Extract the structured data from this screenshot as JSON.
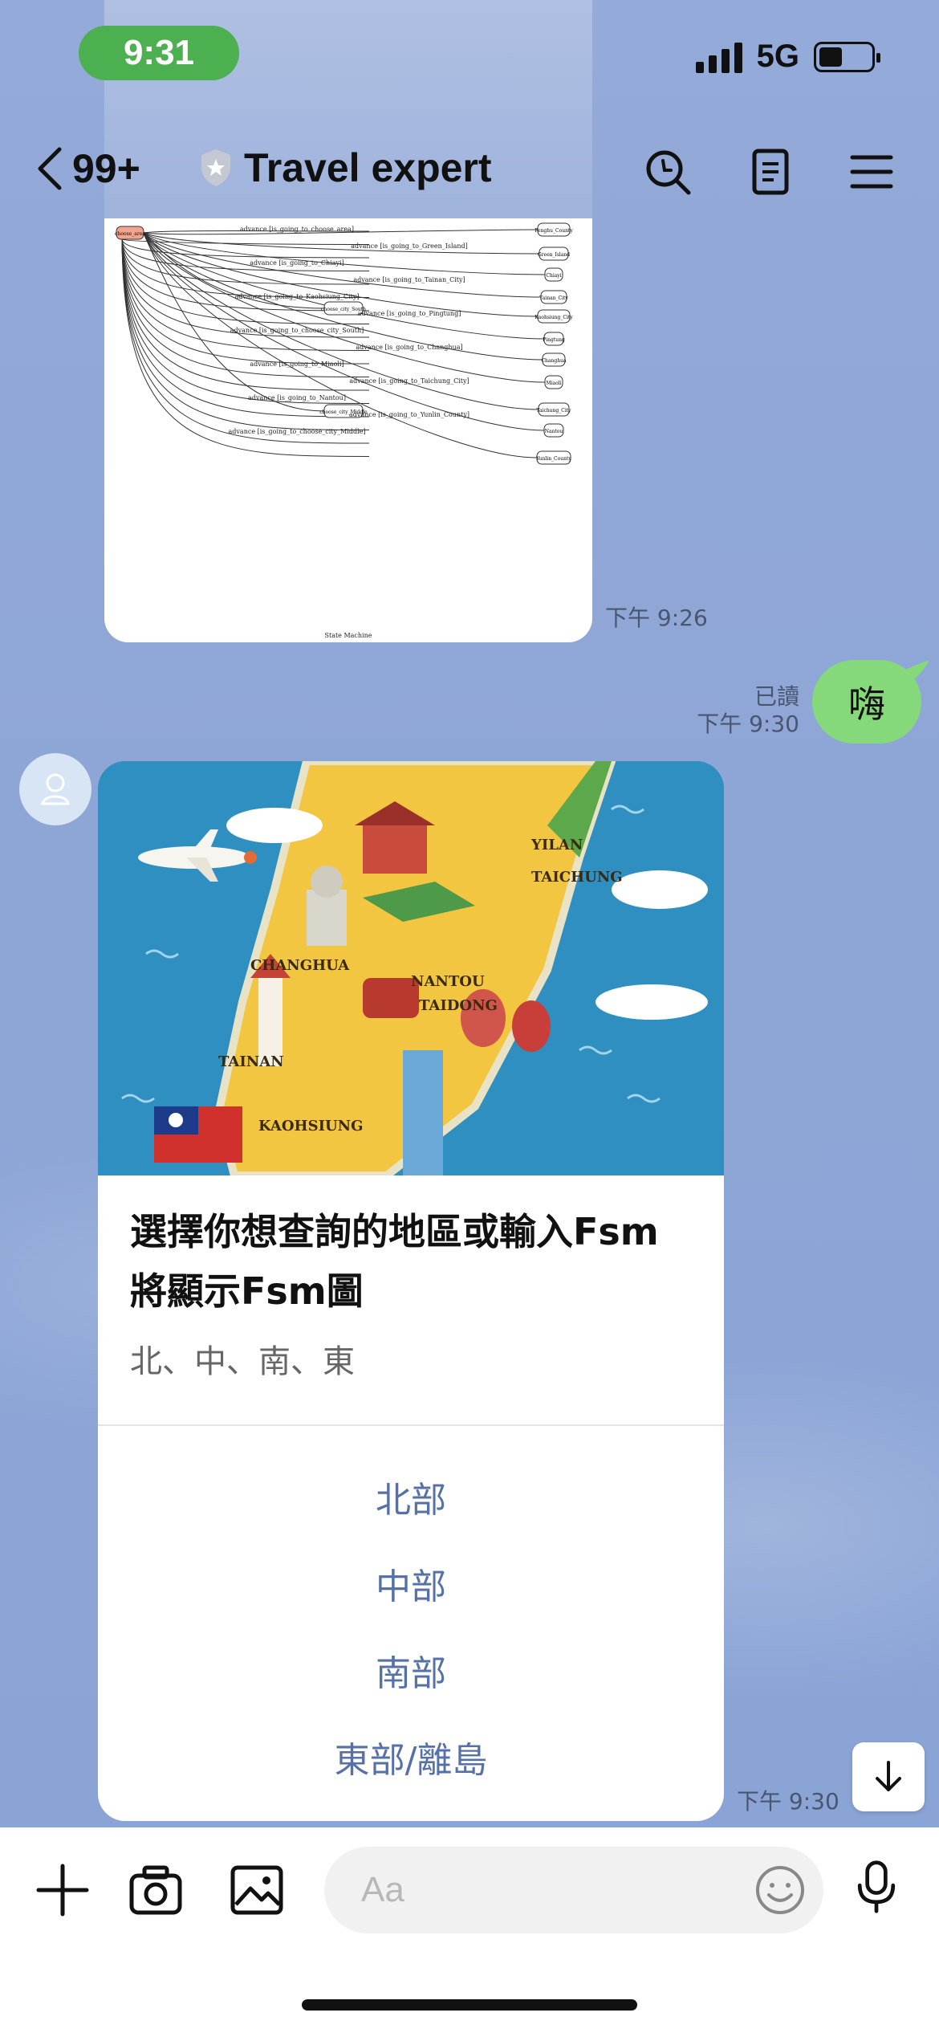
{
  "status_bar": {
    "time": "9:31",
    "network": "5G"
  },
  "header": {
    "back_count": "99+",
    "title": "Travel expert"
  },
  "messages": {
    "diagram_time": "下午 9:26",
    "sent": {
      "text": "嗨",
      "read_label": "已讀",
      "time": "下午 9:30"
    },
    "diagram_labels": {
      "states": [
        "choose_area",
        "Penghu_County",
        "Green_Island",
        "Chiayi",
        "Tainan_City",
        "Kaohsiung_City",
        "Pingtung",
        "Changhua",
        "Miaoli",
        "Taichung_City",
        "Nantou",
        "Yunlin_County",
        "choose_city_South",
        "choose_city_Middle"
      ],
      "edges": [
        "advance [is_going_to_choose_area]",
        "advance [is_going_to_Green_Island]",
        "advance [is_going_to_Chiayi]",
        "advance [is_going_to_Tainan_City]",
        "advance [is_going_to_Kaohsiung_City]",
        "advance [is_going_to_Pingtung]",
        "advance [is_going_to_choose_city_South]",
        "advance [is_going_to_Changhua]",
        "advance [is_going_to_Miaoli]",
        "advance [is_going_to_Taichung_City]",
        "advance [is_going_to_Nantou]",
        "advance [is_going_to_Yunlin_County]",
        "advance [is_going_to_choose_city_Middle]"
      ],
      "caption": "State Machine"
    },
    "hero_labels": [
      "YILAN",
      "TAICHUNG",
      "CHANGHUA",
      "NANTOU",
      "TAIDONG",
      "TAINAN",
      "KAOHSIUNG"
    ],
    "card": {
      "title_line1": "選擇你想查詢的地區或輸入Fsm",
      "title_line2": "將顯示Fsm圖",
      "subtitle": "北、中、南、東",
      "actions": [
        "北部",
        "中部",
        "南部",
        "東部/離島"
      ],
      "time": "下午 9:30"
    }
  },
  "input": {
    "placeholder": "Aa"
  },
  "colors": {
    "status_pill": "#4caf50",
    "sent_bubble": "#86d97b",
    "action_text": "#5571a8",
    "background": "#8fa7d6"
  },
  "icons": [
    "chevron-left-icon",
    "shield-star-icon",
    "search-icon",
    "notes-icon",
    "menu-icon",
    "person-icon",
    "arrow-down-icon",
    "plus-icon",
    "camera-icon",
    "image-icon",
    "emoji-icon",
    "microphone-icon"
  ]
}
